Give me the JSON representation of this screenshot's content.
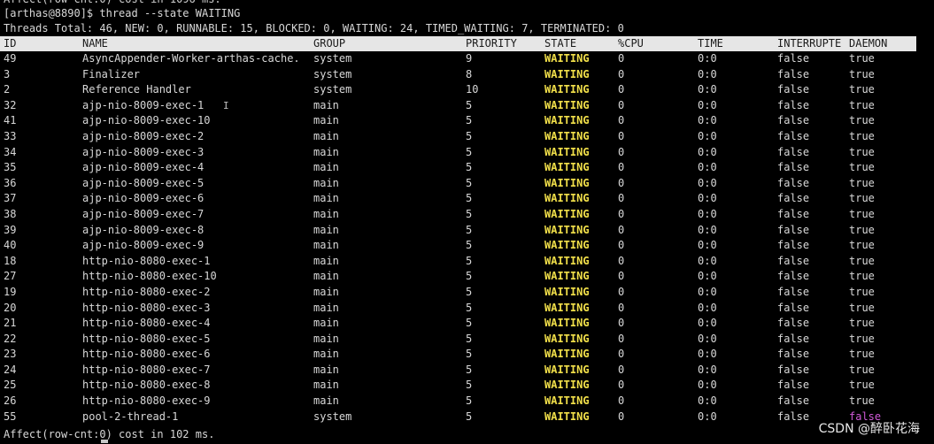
{
  "terminal": {
    "clipped_top": "Affect(row-cnt:0) cost in 1096 ms.",
    "prompt": "[arthas@8890]$ thread --state WAITING",
    "summary": "Threads Total: 46, NEW: 0, RUNNABLE: 15, BLOCKED: 0, WAITING: 24, TIMED_WAITING: 7, TERMINATED: 0",
    "footer": "Affect(row-cnt:0) cost in 102 ms.",
    "cursor_icon": "block-cursor-icon",
    "ibeam_icon": "text-ibeam-icon",
    "ibeam_glyph": "I"
  },
  "colors": {
    "background": "#000000",
    "text": "#d8d8d8",
    "header_bg": "#e6e6e6",
    "waiting": "#f2e04a",
    "false_daemon": "#d05ad8"
  },
  "table": {
    "headers": {
      "id": "ID",
      "name": "NAME",
      "group": "GROUP",
      "priority": "PRIORITY",
      "state": "STATE",
      "cpu": "%CPU",
      "time": "TIME",
      "interrupted": "INTERRUPTE",
      "daemon": "DAEMON"
    },
    "rows": [
      {
        "id": "49",
        "name": "AsyncAppender-Worker-arthas-cache.",
        "group": "system",
        "priority": "9",
        "state": "WAITING",
        "cpu": "0",
        "time": "0:0",
        "interrupted": "false",
        "daemon": "true"
      },
      {
        "id": "3",
        "name": "Finalizer",
        "group": "system",
        "priority": "8",
        "state": "WAITING",
        "cpu": "0",
        "time": "0:0",
        "interrupted": "false",
        "daemon": "true"
      },
      {
        "id": "2",
        "name": "Reference Handler",
        "group": "system",
        "priority": "10",
        "state": "WAITING",
        "cpu": "0",
        "time": "0:0",
        "interrupted": "false",
        "daemon": "true"
      },
      {
        "id": "32",
        "name": "ajp-nio-8009-exec-1",
        "group": "main",
        "priority": "5",
        "state": "WAITING",
        "cpu": "0",
        "time": "0:0",
        "interrupted": "false",
        "daemon": "true"
      },
      {
        "id": "41",
        "name": "ajp-nio-8009-exec-10",
        "group": "main",
        "priority": "5",
        "state": "WAITING",
        "cpu": "0",
        "time": "0:0",
        "interrupted": "false",
        "daemon": "true"
      },
      {
        "id": "33",
        "name": "ajp-nio-8009-exec-2",
        "group": "main",
        "priority": "5",
        "state": "WAITING",
        "cpu": "0",
        "time": "0:0",
        "interrupted": "false",
        "daemon": "true"
      },
      {
        "id": "34",
        "name": "ajp-nio-8009-exec-3",
        "group": "main",
        "priority": "5",
        "state": "WAITING",
        "cpu": "0",
        "time": "0:0",
        "interrupted": "false",
        "daemon": "true"
      },
      {
        "id": "35",
        "name": "ajp-nio-8009-exec-4",
        "group": "main",
        "priority": "5",
        "state": "WAITING",
        "cpu": "0",
        "time": "0:0",
        "interrupted": "false",
        "daemon": "true"
      },
      {
        "id": "36",
        "name": "ajp-nio-8009-exec-5",
        "group": "main",
        "priority": "5",
        "state": "WAITING",
        "cpu": "0",
        "time": "0:0",
        "interrupted": "false",
        "daemon": "true"
      },
      {
        "id": "37",
        "name": "ajp-nio-8009-exec-6",
        "group": "main",
        "priority": "5",
        "state": "WAITING",
        "cpu": "0",
        "time": "0:0",
        "interrupted": "false",
        "daemon": "true"
      },
      {
        "id": "38",
        "name": "ajp-nio-8009-exec-7",
        "group": "main",
        "priority": "5",
        "state": "WAITING",
        "cpu": "0",
        "time": "0:0",
        "interrupted": "false",
        "daemon": "true"
      },
      {
        "id": "39",
        "name": "ajp-nio-8009-exec-8",
        "group": "main",
        "priority": "5",
        "state": "WAITING",
        "cpu": "0",
        "time": "0:0",
        "interrupted": "false",
        "daemon": "true"
      },
      {
        "id": "40",
        "name": "ajp-nio-8009-exec-9",
        "group": "main",
        "priority": "5",
        "state": "WAITING",
        "cpu": "0",
        "time": "0:0",
        "interrupted": "false",
        "daemon": "true"
      },
      {
        "id": "18",
        "name": "http-nio-8080-exec-1",
        "group": "main",
        "priority": "5",
        "state": "WAITING",
        "cpu": "0",
        "time": "0:0",
        "interrupted": "false",
        "daemon": "true"
      },
      {
        "id": "27",
        "name": "http-nio-8080-exec-10",
        "group": "main",
        "priority": "5",
        "state": "WAITING",
        "cpu": "0",
        "time": "0:0",
        "interrupted": "false",
        "daemon": "true"
      },
      {
        "id": "19",
        "name": "http-nio-8080-exec-2",
        "group": "main",
        "priority": "5",
        "state": "WAITING",
        "cpu": "0",
        "time": "0:0",
        "interrupted": "false",
        "daemon": "true"
      },
      {
        "id": "20",
        "name": "http-nio-8080-exec-3",
        "group": "main",
        "priority": "5",
        "state": "WAITING",
        "cpu": "0",
        "time": "0:0",
        "interrupted": "false",
        "daemon": "true"
      },
      {
        "id": "21",
        "name": "http-nio-8080-exec-4",
        "group": "main",
        "priority": "5",
        "state": "WAITING",
        "cpu": "0",
        "time": "0:0",
        "interrupted": "false",
        "daemon": "true"
      },
      {
        "id": "22",
        "name": "http-nio-8080-exec-5",
        "group": "main",
        "priority": "5",
        "state": "WAITING",
        "cpu": "0",
        "time": "0:0",
        "interrupted": "false",
        "daemon": "true"
      },
      {
        "id": "23",
        "name": "http-nio-8080-exec-6",
        "group": "main",
        "priority": "5",
        "state": "WAITING",
        "cpu": "0",
        "time": "0:0",
        "interrupted": "false",
        "daemon": "true"
      },
      {
        "id": "24",
        "name": "http-nio-8080-exec-7",
        "group": "main",
        "priority": "5",
        "state": "WAITING",
        "cpu": "0",
        "time": "0:0",
        "interrupted": "false",
        "daemon": "true"
      },
      {
        "id": "25",
        "name": "http-nio-8080-exec-8",
        "group": "main",
        "priority": "5",
        "state": "WAITING",
        "cpu": "0",
        "time": "0:0",
        "interrupted": "false",
        "daemon": "true"
      },
      {
        "id": "26",
        "name": "http-nio-8080-exec-9",
        "group": "main",
        "priority": "5",
        "state": "WAITING",
        "cpu": "0",
        "time": "0:0",
        "interrupted": "false",
        "daemon": "true"
      },
      {
        "id": "55",
        "name": "pool-2-thread-1",
        "group": "system",
        "priority": "5",
        "state": "WAITING",
        "cpu": "0",
        "time": "0:0",
        "interrupted": "false",
        "daemon": "false"
      }
    ]
  },
  "watermark": "CSDN @醉卧花海"
}
